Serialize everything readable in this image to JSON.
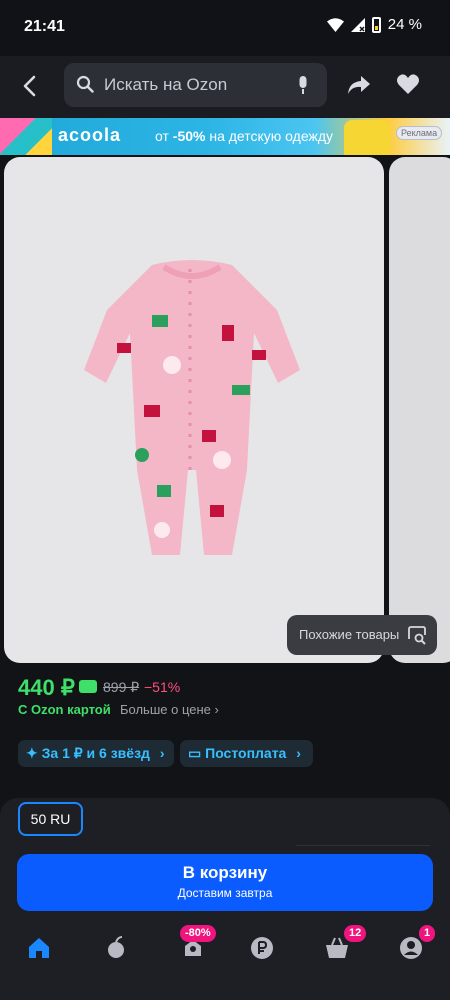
{
  "status_bar": {
    "time": "21:41",
    "battery": "24 %"
  },
  "top_bar": {
    "search_placeholder": "Искать на Ozon"
  },
  "promo": {
    "brand": "acoola",
    "text_prefix": "от",
    "text_bold": "-50%",
    "text_rest": " на детскую одежду",
    "ad_label": "Реклама"
  },
  "gallery": {
    "similar_label": "Похожие товары"
  },
  "product": {
    "price": "440 ₽",
    "old_price": "899 ₽",
    "discount": "−51%",
    "card_label": "С Ozon картой",
    "more_price": "Больше о цене",
    "chips": [
      {
        "label": "За 1 ₽ и 6 звёзд"
      },
      {
        "label": "Постоплата"
      }
    ]
  },
  "purchase": {
    "size": "50 RU",
    "cart_title": "В корзину",
    "cart_subtitle": "Доставим завтра"
  },
  "tab_bar": {
    "badges": {
      "promo": "-80%",
      "cart": "12",
      "profile": "1"
    }
  },
  "colors": {
    "accent_blue": "#0a5cff",
    "price_green": "#3fe06a",
    "discount_pink": "#ff4f7b",
    "badge_pink": "#f0157e"
  }
}
